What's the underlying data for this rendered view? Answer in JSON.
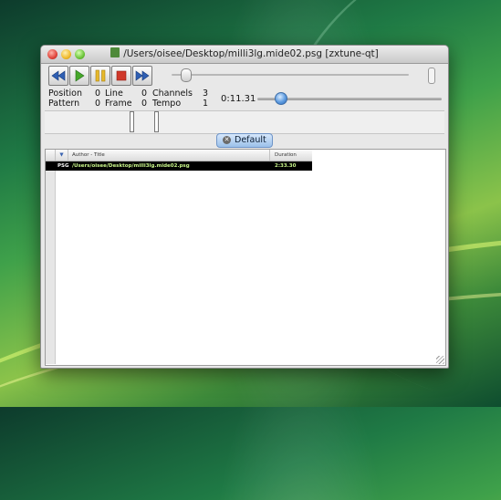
{
  "window": {
    "title": "/Users/oisee/Desktop/milli3lg.mide02.psg [zxtune-qt]",
    "title_icon": "document-icon"
  },
  "toolbar": {
    "buttons": [
      {
        "name": "previous",
        "icon": "rewind-icon"
      },
      {
        "name": "play",
        "icon": "play-icon"
      },
      {
        "name": "pause",
        "icon": "pause-icon"
      },
      {
        "name": "stop",
        "icon": "stop-icon"
      },
      {
        "name": "next",
        "icon": "fast-forward-icon"
      }
    ],
    "seek_fraction": 0.04
  },
  "status": {
    "position_label": "Position",
    "position_value": "0",
    "line_label": "Line",
    "line_value": "0",
    "channels_label": "Channels",
    "channels_value": "3",
    "pattern_label": "Pattern",
    "pattern_value": "0",
    "frame_label": "Frame",
    "frame_value": "0",
    "tempo_label": "Tempo",
    "tempo_value": "1",
    "time": "0:11.31",
    "volume_fraction": 0.1
  },
  "analyzer": {
    "levels": [
      1.0,
      1.0
    ]
  },
  "playlist": {
    "tab_label": "Default",
    "columns": {
      "sort": "▼",
      "author_title": "Author - Title",
      "duration": "Duration"
    },
    "rows": [
      {
        "type": "PSG",
        "title": "/Users/oisee/Desktop/milli3lg.mide02.psg",
        "duration": "2:33.30"
      }
    ]
  },
  "colors": {
    "row_bg": "#000000",
    "row_text": "#c8f58a",
    "accent": "#5d9be0"
  }
}
